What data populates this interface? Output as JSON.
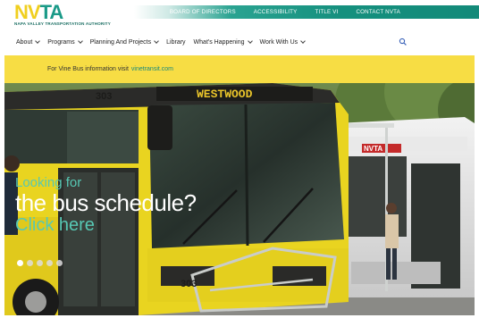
{
  "brand": {
    "logo_text_1": "NV",
    "logo_text_2": "TA",
    "logo_subtitle": "NAPA VALLEY TRANSPORTATION AUTHORITY",
    "color_yellow": "#f0cf1f",
    "color_teal": "#1a9a88"
  },
  "top_links": [
    {
      "label": "BOARD OF DIRECTORS"
    },
    {
      "label": "ACCESSIBILITY"
    },
    {
      "label": "TITLE VI"
    },
    {
      "label": "CONTACT NVTA"
    }
  ],
  "nav": [
    {
      "label": "About",
      "has_dropdown": true
    },
    {
      "label": "Programs",
      "has_dropdown": true
    },
    {
      "label": "Planning And Projects",
      "has_dropdown": true
    },
    {
      "label": "Library",
      "has_dropdown": false
    },
    {
      "label": "What's Happening",
      "has_dropdown": true
    },
    {
      "label": "Work With Us",
      "has_dropdown": true
    }
  ],
  "search_icon": "search-icon",
  "notice": {
    "text": "For Vine Bus information visit",
    "link": "vinetransit.com"
  },
  "hero": {
    "line1": "Looking for",
    "line2": "the bus schedule?",
    "line3": "Click here",
    "bus_sign": "WESTWOOD",
    "bus_number": "303",
    "bus2_label": "NVTA",
    "slides_total": 5,
    "active_slide": 1
  }
}
